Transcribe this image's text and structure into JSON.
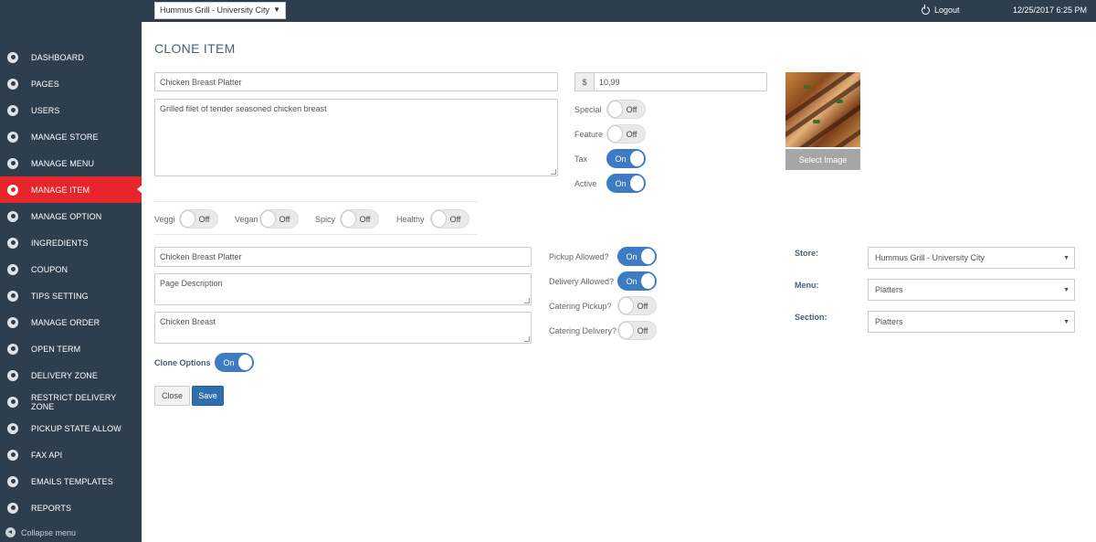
{
  "topbar": {
    "store_selected": "Hummus Grill - University City",
    "logout_label": "Logout",
    "datetime": "12/25/2017 6:25 PM"
  },
  "sidebar": {
    "items": [
      {
        "label": "DASHBOARD",
        "icon": "dashboard-icon"
      },
      {
        "label": "PAGES",
        "icon": "pages-icon"
      },
      {
        "label": "USERS",
        "icon": "user-icon"
      },
      {
        "label": "MANAGE STORE",
        "icon": "gear-icon"
      },
      {
        "label": "MANAGE MENU",
        "icon": "gear-icon"
      },
      {
        "label": "MANAGE ITEM",
        "icon": "gear-icon",
        "active": true
      },
      {
        "label": "MANAGE OPTION",
        "icon": "gear-icon"
      },
      {
        "label": "INGREDIENTS",
        "icon": "gear-icon"
      },
      {
        "label": "COUPON",
        "icon": "gear-icon"
      },
      {
        "label": "TIPS SETTING",
        "icon": "gear-icon"
      },
      {
        "label": "MANAGE ORDER",
        "icon": "gear-icon"
      },
      {
        "label": "OPEN TERM",
        "icon": "gear-icon"
      },
      {
        "label": "DELIVERY ZONE",
        "icon": "gear-icon"
      },
      {
        "label": "RESTRICT DELIVERY ZONE",
        "icon": "gear-icon"
      },
      {
        "label": "PICKUP STATE ALLOW",
        "icon": "gear-icon"
      },
      {
        "label": "FAX API",
        "icon": "gear-icon"
      },
      {
        "label": "EMAILS TEMPLATES",
        "icon": "gear-icon"
      },
      {
        "label": "REPORTS",
        "icon": "gear-icon"
      }
    ],
    "collapse_label": "Collapse menu"
  },
  "page": {
    "title": "CLONE ITEM"
  },
  "item": {
    "name": "Chicken Breast Platter",
    "description": "Grilled filet of tender seasoned chicken breast",
    "price_prefix": "$",
    "price": "10,99",
    "select_image_label": "Select Image"
  },
  "flags": {
    "special": {
      "label": "Special",
      "state": "Off"
    },
    "feature": {
      "label": "Feature",
      "state": "Off"
    },
    "tax": {
      "label": "Tax",
      "state": "On"
    },
    "active": {
      "label": "Active",
      "state": "On"
    }
  },
  "diet": {
    "veggi": {
      "label": "Veggi",
      "state": "Off"
    },
    "vegan": {
      "label": "Vegan",
      "state": "Off"
    },
    "spicy": {
      "label": "Spicy",
      "state": "Off"
    },
    "healthy": {
      "label": "Healthy",
      "state": "Off"
    }
  },
  "page_meta": {
    "page_title": "Chicken Breast Platter",
    "page_description_placeholder": "Page Description",
    "keywords": "Chicken Breast"
  },
  "service": {
    "pickup": {
      "label": "Pickup Allowed?",
      "state": "On"
    },
    "delivery": {
      "label": "Delivery Allowed?",
      "state": "On"
    },
    "catering_pickup": {
      "label": "Catering Pickup?",
      "state": "Off"
    },
    "catering_delivery": {
      "label": "Catering Delivery?",
      "state": "Off"
    }
  },
  "clone_options": {
    "label": "Clone Options",
    "state": "On"
  },
  "location": {
    "store_label": "Store:",
    "store_value": "Hummus Grill - University City",
    "menu_label": "Menu:",
    "menu_value": "Platters",
    "section_label": "Section:",
    "section_value": "Platters"
  },
  "actions": {
    "close_label": "Close",
    "save_label": "Save"
  },
  "colors": {
    "sidebar_bg": "#2d3e4f",
    "active_item": "#e6262b",
    "toggle_on": "#3d7cc4",
    "save_button": "#2f6fad"
  }
}
